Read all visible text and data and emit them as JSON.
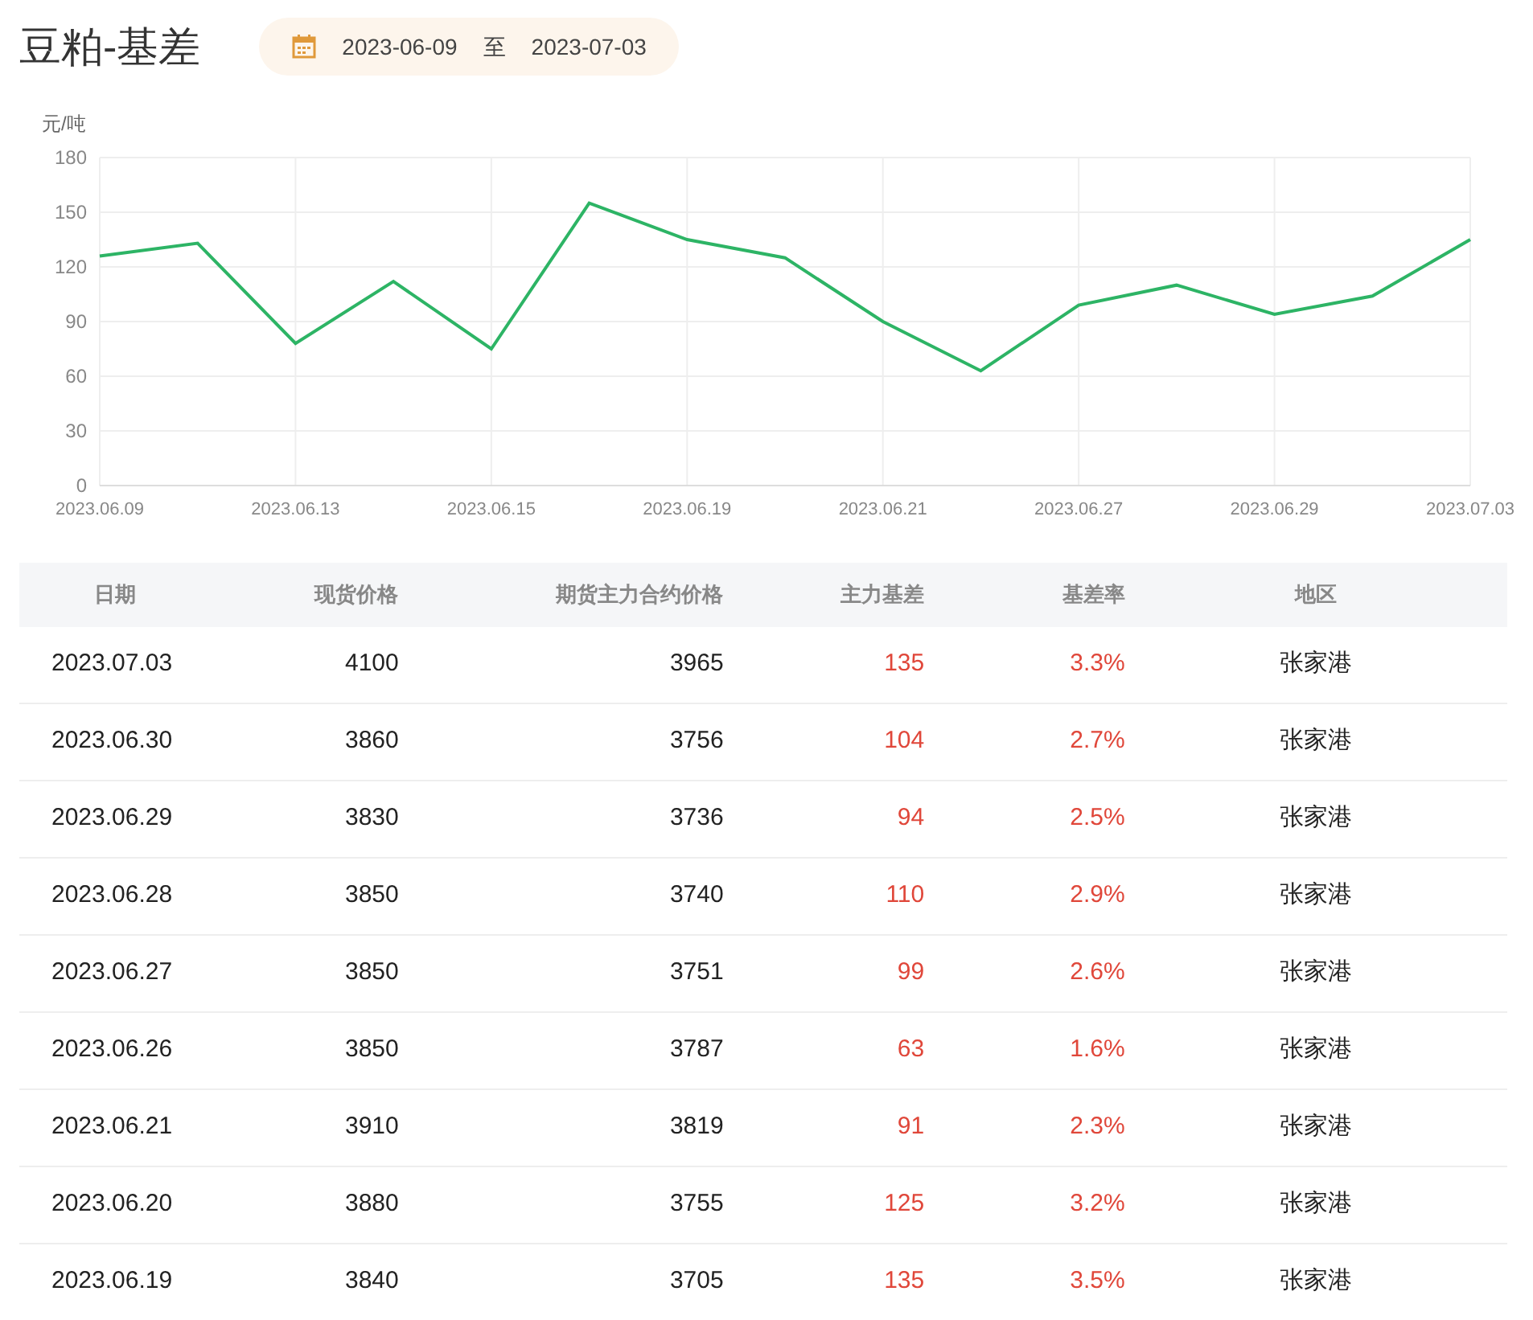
{
  "title": "豆粕-基差",
  "date_range": {
    "start": "2023-06-09",
    "separator": "至",
    "end": "2023-07-03"
  },
  "chart": {
    "chart_data": {
      "type": "line",
      "ylabel": "元/吨",
      "categories": [
        "2023.06.09",
        null,
        "2023.06.13",
        null,
        "2023.06.15",
        null,
        "2023.06.19",
        null,
        "2023.06.21",
        null,
        "2023.06.27",
        null,
        "2023.06.29",
        null,
        "2023.07.03"
      ],
      "series": [
        {
          "color": "#2db465",
          "values": [
            126,
            133,
            78,
            112,
            75,
            155,
            135,
            125,
            90,
            63,
            99,
            110,
            94,
            104,
            135
          ]
        }
      ],
      "ylim": [
        0,
        180
      ],
      "yticks": [
        0,
        30,
        60,
        90,
        120,
        150,
        180
      ],
      "grid": true
    }
  },
  "table": {
    "columns": [
      "日期",
      "现货价格",
      "期货主力合约价格",
      "主力基差",
      "基差率",
      "地区"
    ],
    "rows": [
      [
        "2023.07.03",
        "4100",
        "3965",
        "135",
        "3.3%",
        "张家港"
      ],
      [
        "2023.06.30",
        "3860",
        "3756",
        "104",
        "2.7%",
        "张家港"
      ],
      [
        "2023.06.29",
        "3830",
        "3736",
        "94",
        "2.5%",
        "张家港"
      ],
      [
        "2023.06.28",
        "3850",
        "3740",
        "110",
        "2.9%",
        "张家港"
      ],
      [
        "2023.06.27",
        "3850",
        "3751",
        "99",
        "2.6%",
        "张家港"
      ],
      [
        "2023.06.26",
        "3850",
        "3787",
        "63",
        "1.6%",
        "张家港"
      ],
      [
        "2023.06.21",
        "3910",
        "3819",
        "91",
        "2.3%",
        "张家港"
      ],
      [
        "2023.06.20",
        "3880",
        "3755",
        "125",
        "3.2%",
        "张家港"
      ],
      [
        "2023.06.19",
        "3840",
        "3705",
        "135",
        "3.5%",
        "张家港"
      ]
    ]
  }
}
